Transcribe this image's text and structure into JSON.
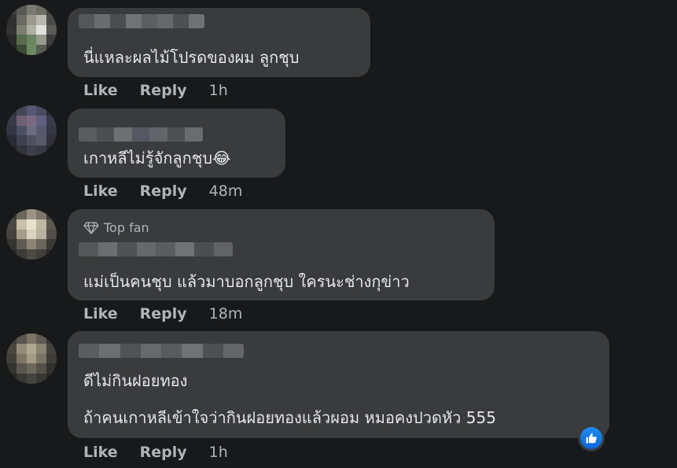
{
  "comments": [
    {
      "text_lines": [
        "นี่แหละผลไม้โปรดของผม ลูกชุบ"
      ],
      "actions": {
        "like": "Like",
        "reply": "Reply",
        "time": "1h"
      }
    },
    {
      "text_lines": [
        "เกาหลีไม่รู้จักลูกชุบ"
      ],
      "emoji": "😂",
      "actions": {
        "like": "Like",
        "reply": "Reply",
        "time": "48m"
      }
    },
    {
      "badge": "Top fan",
      "text_lines": [
        "แม่เป็นคนชุบ แล้วมาบอกลูกชุบ ใครนะช่างกุข่าว"
      ],
      "actions": {
        "like": "Like",
        "reply": "Reply",
        "time": "18m"
      }
    },
    {
      "text_lines": [
        "ดีไม่กินฝอยทอง",
        "ถ้าคนเกาหลีเข้าใจว่ากินฝอยทองแล้วผอม หมอคงปวดหัว 555"
      ],
      "actions": {
        "like": "Like",
        "reply": "Reply",
        "time": "1h"
      }
    }
  ],
  "colors": {
    "background": "#18191a",
    "bubble": "#3a3b3c",
    "text": "#e4e6eb",
    "secondary": "#b0b3b8",
    "like_blue": "#1877f2"
  },
  "icons": [
    "diamond-icon",
    "thumbs-up-icon"
  ]
}
